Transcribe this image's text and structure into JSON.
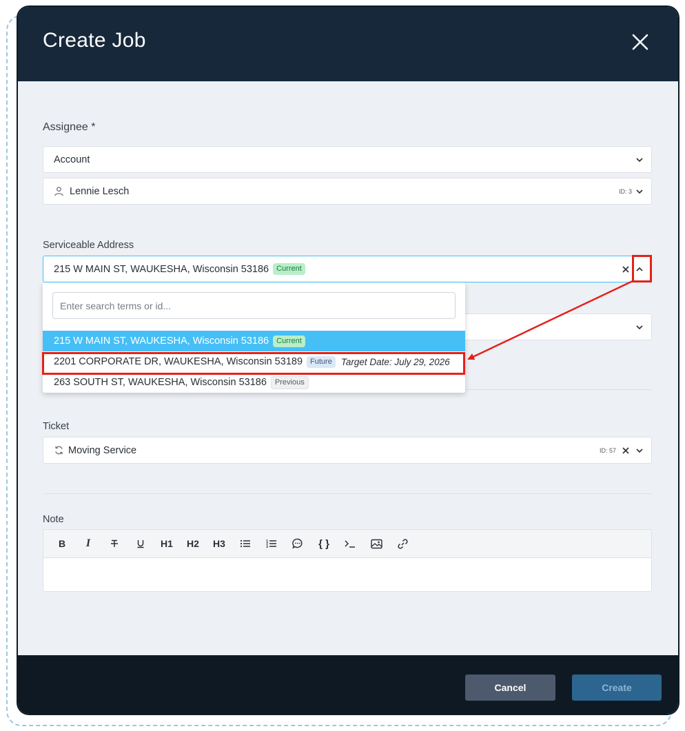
{
  "modal": {
    "title": "Create Job"
  },
  "assignee": {
    "label": "Assignee *",
    "account_value": "Account",
    "person_value": "Lennie Lesch",
    "person_id": "ID: 3"
  },
  "serviceable_address": {
    "label": "Serviceable Address",
    "selected_value": "215 W MAIN ST, WAUKESHA, Wisconsin 53186",
    "selected_badge": "Current",
    "search_placeholder": "Enter search terms or id...",
    "options": [
      {
        "address": "215 W MAIN ST, WAUKESHA, Wisconsin 53186",
        "badge": "Current",
        "selected": true
      },
      {
        "address": "2201 CORPORATE DR, WAUKESHA, Wisconsin 53189",
        "badge": "Future",
        "target_date": "Target Date: July 29, 2026",
        "selected": false
      },
      {
        "address": "263 SOUTH ST, WAUKESHA, Wisconsin 53186",
        "badge": "Previous",
        "selected": false
      }
    ]
  },
  "ticket": {
    "label": "Ticket",
    "value": "Moving Service",
    "id": "ID: 57"
  },
  "note": {
    "label": "Note",
    "toolbar": [
      "B",
      "I",
      "S",
      "U",
      "H1",
      "H2",
      "H3",
      "bullet-list",
      "ordered-list",
      "comment",
      "{ }",
      ">_",
      "image",
      "link"
    ]
  },
  "footer": {
    "cancel_label": "Cancel",
    "create_label": "Create"
  },
  "colors": {
    "header": "#17283b",
    "footer": "#0f1923",
    "selected_option": "#45bff6",
    "annotation": "#e32119"
  }
}
